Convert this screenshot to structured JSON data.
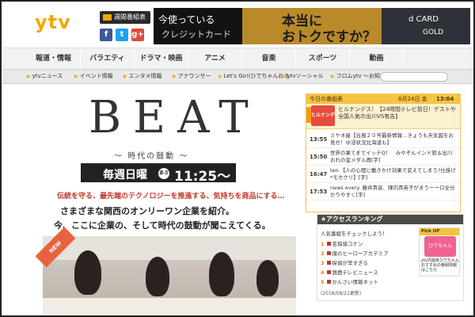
{
  "header": {
    "logo": "ytv",
    "tv_schedule": "週間番組表",
    "social": {
      "facebook": "f",
      "twitter": "t",
      "googleplus": "g+"
    },
    "ad": {
      "line1": "今使っている",
      "line2": "クレジットカード",
      "main1": "本当に",
      "main2": "おトクですか？",
      "brand1": "d CARD",
      "brand2": "GOLD"
    }
  },
  "mainnav": {
    "items": [
      "報道・情報",
      "バラエティ",
      "ドラマ・映画",
      "アニメ",
      "音楽",
      "スポーツ",
      "動画"
    ]
  },
  "subnav": {
    "items": [
      "ytvニュース",
      "イベント情報",
      "エンタメ情報",
      "アナウンサー",
      "Let's Go!(ひでちゃんねる",
      "ytvソーシャル",
      "フロムytv ～お知らせなど18～"
    ]
  },
  "main": {
    "title": "BEAT",
    "subtitle": "〜 時代の鼓動 〜",
    "airday": "毎週日曜",
    "airtime": "11:25〜",
    "badge": "あさ",
    "tagline": "伝統を守る、最先端のテクノロジーを推進する、気持ちを商品にする…",
    "desc1": "さまざまな関西のオンリーワン企業を紹介。",
    "desc2": "今、ここに企業の、そして時代の鼓動が聞こえてくる。",
    "new_label": "NEW"
  },
  "schedule": {
    "header": "今日の番組表",
    "date": "8月24日 金",
    "time": "13:04",
    "onair_thumb": "ヒルナンデス",
    "onair_text": "ヒルナンデス！【24時間テレビ前日！ゲストや全国人気の出川VS有吉】",
    "programs": [
      {
        "time": "13:55",
        "text": "ミヤネ屋【台風２０号最新情報…きょうも天気図をお見せ！ゆ浸状況北海道も】"
      },
      {
        "time": "15:50",
        "text": "世界の果てまでイッテQ！　みやぞんインド旅＆出川おれの金メダル再[字]"
      },
      {
        "time": "16:47",
        "text": "ten.【人の心理に働きかけ効果で変えてしまう?仕掛け*モカクリ】[字]"
      },
      {
        "time": "17:53",
        "text": "news every. 藤井貴音、陳内貴英子がまうーーロ全分かりやすく[字]"
      }
    ]
  },
  "ranking": {
    "header": "★アクセスランキング",
    "sub": "人気番組をチェックしよう！",
    "items": [
      {
        "n": "1",
        "title": "名探偵コナン"
      },
      {
        "n": "2",
        "title": "僕のヒーローアカデミア"
      },
      {
        "n": "3",
        "title": "探偵が早すぎる"
      },
      {
        "n": "4",
        "title": "鉄鹿テレビニュース"
      },
      {
        "n": "5",
        "title": "かんさい情報ネット"
      }
    ],
    "date": "(2018/08/21更新)",
    "pickup_head": "Pick UP",
    "pickup_img": "ひでちゃん",
    "pickup_text": "ytv内独身ひでちゃんおすすめの番組情報はこちら"
  }
}
